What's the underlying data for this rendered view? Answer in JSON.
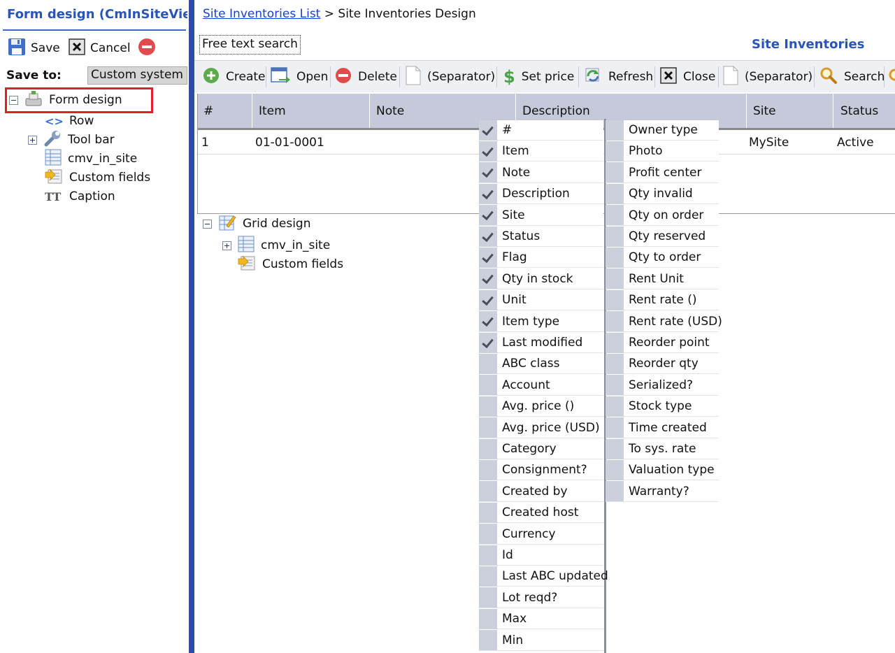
{
  "left_panel": {
    "title": "Form design (CmInSiteViewItem)",
    "buttons": {
      "save": "Save",
      "cancel": "Cancel"
    },
    "save_to_label": "Save to:",
    "save_to_value": "Custom system",
    "tree": {
      "root": "Form design",
      "children": [
        "Row",
        "Tool bar",
        "cmv_in_site",
        "Custom fields",
        "Caption"
      ]
    }
  },
  "main": {
    "breadcrumb": {
      "link": "Site Inventories List",
      "separator": " > ",
      "current": "Site Inventories Design"
    },
    "free_search": "Free text search",
    "grid_title": "Site Inventories",
    "toolbar": [
      "Create",
      "Open",
      "Delete",
      "(Separator)",
      "Set price",
      "Refresh",
      "Close",
      "(Separator)",
      "Search"
    ],
    "grid": {
      "columns": [
        "#",
        "Item",
        "Note",
        "Description",
        "Site",
        "Status"
      ],
      "rows": [
        {
          "num": "1",
          "item": "01-01-0001",
          "site": "MySite",
          "status": "Active"
        }
      ]
    },
    "grid_design": {
      "root": "Grid design",
      "children": [
        "cmv_in_site",
        "Custom fields"
      ]
    }
  },
  "column_chooser": {
    "left": [
      {
        "label": "#",
        "checked": true
      },
      {
        "label": "Item",
        "checked": true
      },
      {
        "label": "Note",
        "checked": true
      },
      {
        "label": "Description",
        "checked": true
      },
      {
        "label": "Site",
        "checked": true
      },
      {
        "label": "Status",
        "checked": true
      },
      {
        "label": "Flag",
        "checked": true
      },
      {
        "label": "Qty in stock",
        "checked": true
      },
      {
        "label": "Unit",
        "checked": true
      },
      {
        "label": "Item type",
        "checked": true
      },
      {
        "label": "Last modified",
        "checked": true
      },
      {
        "label": "ABC class",
        "checked": false
      },
      {
        "label": "Account",
        "checked": false
      },
      {
        "label": "Avg. price ()",
        "checked": false
      },
      {
        "label": "Avg. price (USD)",
        "checked": false
      },
      {
        "label": "Category",
        "checked": false
      },
      {
        "label": "Consignment?",
        "checked": false
      },
      {
        "label": "Created by",
        "checked": false
      },
      {
        "label": "Created host",
        "checked": false
      },
      {
        "label": "Currency",
        "checked": false
      },
      {
        "label": "Id",
        "checked": false
      },
      {
        "label": "Last ABC updated",
        "checked": false
      },
      {
        "label": "Lot reqd?",
        "checked": false
      },
      {
        "label": "Max",
        "checked": false
      },
      {
        "label": "Min",
        "checked": false
      }
    ],
    "right": [
      {
        "label": "Owner type",
        "checked": false
      },
      {
        "label": "Photo",
        "checked": false
      },
      {
        "label": "Profit center",
        "checked": false
      },
      {
        "label": "Qty invalid",
        "checked": false
      },
      {
        "label": "Qty on order",
        "checked": false
      },
      {
        "label": "Qty reserved",
        "checked": false
      },
      {
        "label": "Qty to order",
        "checked": false
      },
      {
        "label": "Rent Unit",
        "checked": false
      },
      {
        "label": "Rent rate ()",
        "checked": false
      },
      {
        "label": "Rent rate (USD)",
        "checked": false
      },
      {
        "label": "Reorder point",
        "checked": false
      },
      {
        "label": "Reorder qty",
        "checked": false
      },
      {
        "label": "Serialized?",
        "checked": false
      },
      {
        "label": "Stock type",
        "checked": false
      },
      {
        "label": "Time created",
        "checked": false
      },
      {
        "label": "To sys. rate",
        "checked": false
      },
      {
        "label": "Valuation type",
        "checked": false
      },
      {
        "label": "Warranty?",
        "checked": false
      }
    ]
  },
  "colors": {
    "accent": "#2a55b4",
    "divider": "#2c4e9c",
    "highlight_border": "#e0202a",
    "header_bg": "#c5c9d9"
  }
}
